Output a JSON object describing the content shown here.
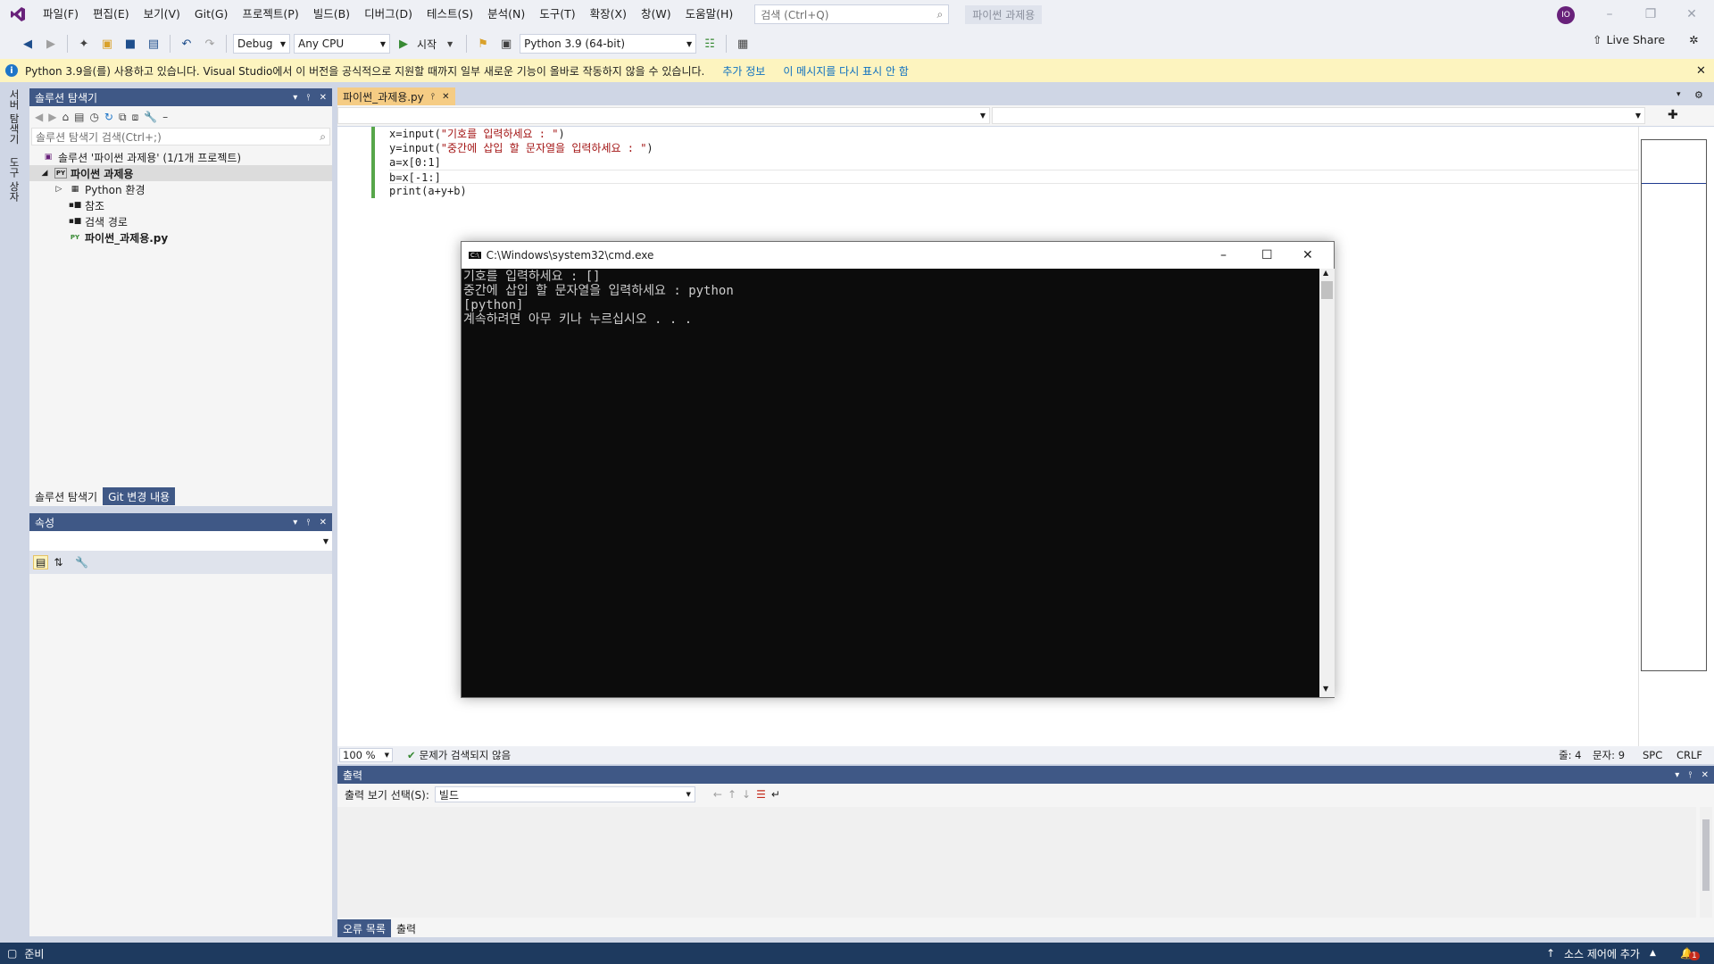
{
  "menu": {
    "items": [
      "파일(F)",
      "편집(E)",
      "보기(V)",
      "Git(G)",
      "프로젝트(P)",
      "빌드(B)",
      "디버그(D)",
      "테스트(S)",
      "분석(N)",
      "도구(T)",
      "확장(X)",
      "창(W)",
      "도움말(H)"
    ],
    "search_placeholder": "검색 (Ctrl+Q)",
    "solution_name": "파이썬 과제용",
    "user_initials": "IO"
  },
  "toolbar": {
    "config": "Debug",
    "platform": "Any CPU",
    "start_label": "시작",
    "python_env": "Python 3.9 (64-bit)",
    "live_share": "Live Share"
  },
  "infobar": {
    "message": "Python 3.9을(를) 사용하고 있습니다. Visual Studio에서 이 버전을 공식적으로 지원할 때까지 일부 새로운 기능이 올바로 작동하지 않을 수 있습니다.",
    "link_more": "추가 정보",
    "link_dismiss": "이 메시지를 다시 표시 안 함"
  },
  "left_strip": {
    "tab1": "서버 탐색기",
    "tab2": "도구 상자"
  },
  "solution_explorer": {
    "title": "솔루션 탐색기",
    "search_placeholder": "솔루션 탐색기 검색(Ctrl+;)",
    "tree": [
      {
        "label": "솔루션 '파이썬 과제용' (1/1개 프로젝트)",
        "level": 0,
        "bold": false
      },
      {
        "label": "파이썬 과제용",
        "level": 1,
        "bold": true
      },
      {
        "label": "Python 환경",
        "level": 2,
        "bold": false
      },
      {
        "label": "참조",
        "level": 2,
        "bold": false
      },
      {
        "label": "검색 경로",
        "level": 2,
        "bold": false
      },
      {
        "label": "파이썬_과제용.py",
        "level": 2,
        "bold": true
      }
    ],
    "bottom_tabs": [
      "솔루션 탐색기",
      "Git 변경 내용"
    ]
  },
  "properties": {
    "title": "속성"
  },
  "editor": {
    "tab_label": "파이썬_과제용.py",
    "lines": [
      {
        "pre": "x=input(",
        "str": "\"기호를 입력하세요 : \"",
        "post": ")"
      },
      {
        "pre": "y=input(",
        "str": "\"중간에 삽입 할 문자열을 입력하세요 : \"",
        "post": ")"
      },
      {
        "pre": "a=x[0:1]",
        "str": "",
        "post": ""
      },
      {
        "pre": "b=x[-1:]",
        "str": "",
        "post": ""
      },
      {
        "pre": "print(a+y+b)",
        "str": "",
        "post": ""
      }
    ],
    "zoom": "100 %",
    "issues": "문제가 검색되지 않음",
    "line_info": "줄: 4",
    "col_info": "문자: 9",
    "ws": "SPC",
    "eol": "CRLF"
  },
  "cmd": {
    "title": "C:\\Windows\\system32\\cmd.exe",
    "lines": [
      "기호를 입력하세요 : []",
      "중간에 삽입 할 문자열을 입력하세요 : python",
      "[python]",
      "계속하려면 아무 키나 누르십시오 . . ."
    ]
  },
  "output": {
    "title": "출력",
    "source_label": "출력 보기 선택(S):",
    "source_value": "빌드",
    "tabs": [
      "오류 목록",
      "출력"
    ]
  },
  "statusbar": {
    "ready": "준비",
    "source_control": "소스 제어에 추가",
    "notifications": "1"
  },
  "colors": {
    "accent": "#3f5886",
    "status_bar": "#1e3a5f",
    "tab_active": "#f5cc84",
    "string": "#a31515"
  }
}
